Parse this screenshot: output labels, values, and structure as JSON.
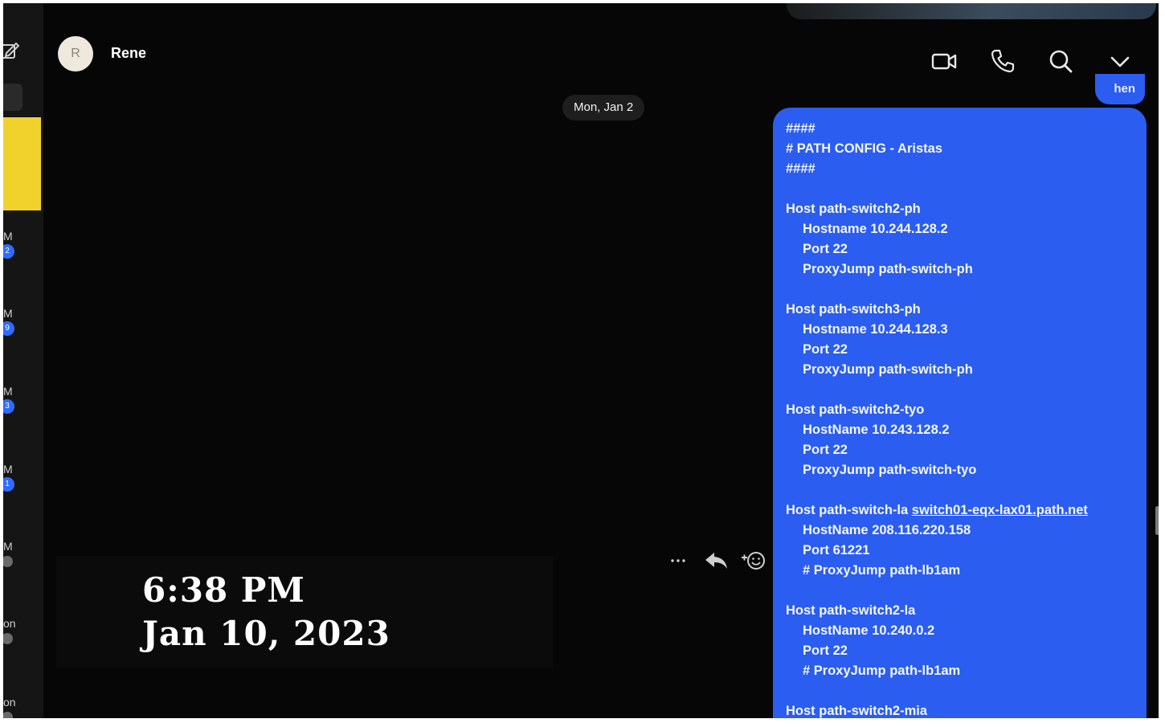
{
  "header": {
    "avatar_initial": "R",
    "contact_name": "Rene",
    "icons": [
      "video-call-icon",
      "phone-call-icon",
      "search-icon",
      "chevron-down-icon"
    ]
  },
  "sidebar": {
    "entries": [
      {
        "label": "M",
        "badge": "2"
      },
      {
        "label": "M",
        "badge": "9"
      },
      {
        "label": "M",
        "badge": "3"
      },
      {
        "label": "M",
        "badge": "1"
      },
      {
        "label": "M",
        "badge": ""
      },
      {
        "label": "on",
        "badge": ""
      },
      {
        "label": "on",
        "badge": ""
      }
    ]
  },
  "conversation": {
    "date_separator": "Mon, Jan 2",
    "previous_message_fragment": "hen",
    "message_lines": [
      "####",
      "# PATH CONFIG - Aristas",
      "####",
      "",
      "Host path-switch2-ph",
      "  Hostname 10.244.128.2",
      "  Port 22",
      "  ProxyJump path-switch-ph",
      "",
      "Host path-switch3-ph",
      "  Hostname 10.244.128.3",
      "  Port 22",
      "  ProxyJump path-switch-ph",
      "",
      "Host path-switch2-tyo",
      "  HostName 10.243.128.2",
      "  Port 22",
      "  ProxyJump path-switch-tyo",
      "",
      "Host path-switch-la switch01-eqx-lax01.path.net",
      "  HostName 208.116.220.158",
      "  Port 61221",
      "  # ProxyJump path-lb1am",
      "",
      "Host path-switch2-la",
      "  HostName 10.240.0.2",
      "  Port 22",
      "  # ProxyJump path-lb1am",
      "",
      "Host path-switch2-mia"
    ],
    "link_text": "switch01-eqx-lax01.path.net"
  },
  "message_actions": {
    "more": "···",
    "icons": [
      "more-icon",
      "reply-icon",
      "add-reaction-icon"
    ]
  },
  "overlay": {
    "time": "6:38 PM",
    "date": "Jan 10, 2023"
  },
  "colors": {
    "background": "#060606",
    "bubble": "#2a5df0",
    "sidebar_note": "#f1d22c",
    "badge": "#2f6bff"
  }
}
